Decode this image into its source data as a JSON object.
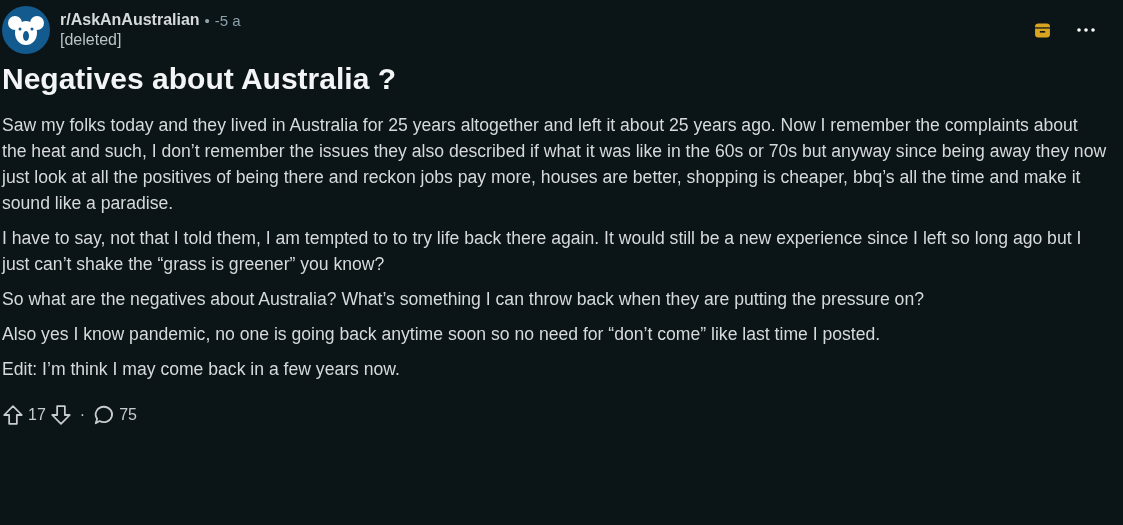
{
  "post": {
    "subreddit": "r/AskAnAustralian",
    "separator": "•",
    "age": "-5 a",
    "author": "[deleted]",
    "title": "Negatives about Australia ?",
    "paragraphs": [
      "Saw my folks today and they lived in Australia for 25 years altogether and left it about 25 years ago. Now I remember the complaints about the heat and such, I don’t remember the issues they also described if what it was like in the 60s or 70s but anyway since being away they now just look at all the positives of being there and reckon jobs pay more, houses are better, shopping is cheaper, bbq’s all the time and make it sound like a paradise.",
      "I have to say, not that I told them, I am tempted to to try life back there again. It would still be a new experience since I left so long ago but I just can’t shake the “grass is greener” you know?",
      "So what are the negatives about Australia? What’s something I can throw back when they are putting the pressure on?",
      "Also yes I know pandemic, no one is going back anytime soon so no need for “don’t come” like last time I posted.",
      "Edit: I’m think I may come back in a few years now."
    ],
    "score": "17",
    "dot": "·",
    "comments": "75"
  }
}
